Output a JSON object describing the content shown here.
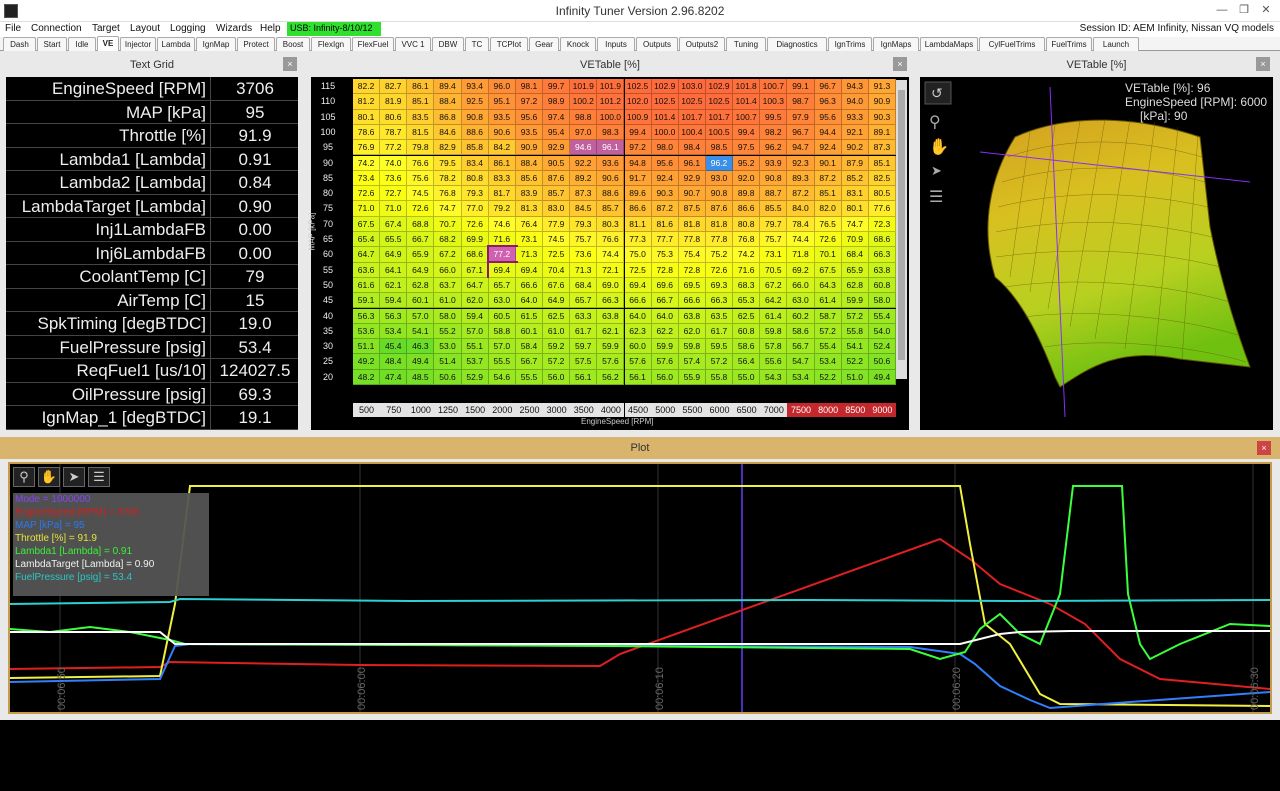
{
  "window": {
    "title": "Infinity Tuner Version 2.96.8202"
  },
  "menu": {
    "items": [
      "File",
      "Connection",
      "Target",
      "Layout",
      "Logging",
      "Wizards",
      "Help"
    ],
    "usb_status": "USB: Infinity-8/10/12",
    "session": "Session ID: AEM Infinity, Nissan VQ models"
  },
  "tabs": [
    "Dash",
    "Start",
    "Idle",
    "VE",
    "Injector",
    "Lambda",
    "IgnMap",
    "Protect",
    "Boost",
    "FlexIgn",
    "FlexFuel",
    "VVC 1",
    "DBW",
    "TC",
    "TCPlot",
    "Gear",
    "Knock",
    "Inputs",
    "Outputs",
    "Outputs2",
    "Tuning",
    "Diagnostics",
    "IgnTrims",
    "IgnMaps",
    "LambdaMaps",
    "CylFuelTrims",
    "FuelTrims",
    "Launch"
  ],
  "active_tab": "VE",
  "text_grid": {
    "title": "Text Grid",
    "rows": [
      {
        "name": "EngineSpeed [RPM]",
        "value": "3706"
      },
      {
        "name": "MAP [kPa]",
        "value": "95"
      },
      {
        "name": "Throttle [%]",
        "value": "91.9"
      },
      {
        "name": "Lambda1 [Lambda]",
        "value": "0.91"
      },
      {
        "name": "Lambda2 [Lambda]",
        "value": "0.84"
      },
      {
        "name": "LambdaTarget [Lambda]",
        "value": "0.90"
      },
      {
        "name": "Inj1LambdaFB",
        "value": "0.00"
      },
      {
        "name": "Inj6LambdaFB",
        "value": "0.00"
      },
      {
        "name": "CoolantTemp [C]",
        "value": "79"
      },
      {
        "name": "AirTemp [C]",
        "value": "15"
      },
      {
        "name": "SpkTiming [degBTDC]",
        "value": "19.0"
      },
      {
        "name": "FuelPressure [psig]",
        "value": "53.4"
      },
      {
        "name": "ReqFuel1 [us/10]",
        "value": "124027.5"
      },
      {
        "name": "OilPressure [psig]",
        "value": "69.3"
      },
      {
        "name": "IgnMap_1 [degBTDC]",
        "value": "19.1"
      }
    ]
  },
  "ve_table": {
    "title": "VETable [%]",
    "x_axis_label": "EngineSpeed [RPM]",
    "y_axis_label": "MAP [kPa]",
    "x": [
      "500",
      "750",
      "1000",
      "1250",
      "1500",
      "2000",
      "2500",
      "3000",
      "3500",
      "4000",
      "4500",
      "5000",
      "5500",
      "6000",
      "6500",
      "7000",
      "7500",
      "8000",
      "8500",
      "9000"
    ],
    "y": [
      "115",
      "110",
      "105",
      "100",
      "95",
      "90",
      "85",
      "80",
      "75",
      "70",
      "65",
      "60",
      "55",
      "50",
      "45",
      "40",
      "35",
      "30",
      "25",
      "20"
    ],
    "rows": [
      [
        "82.2",
        "82.7",
        "86.1",
        "89.4",
        "93.4",
        "96.0",
        "98.1",
        "99.7",
        "101.9",
        "101.9",
        "102.5",
        "102.9",
        "103.0",
        "102.9",
        "101.8",
        "100.7",
        "99.1",
        "96.7",
        "94.3",
        "91.3"
      ],
      [
        "81.2",
        "81.9",
        "85.1",
        "88.4",
        "92.5",
        "95.1",
        "97.2",
        "98.9",
        "100.2",
        "101.2",
        "102.0",
        "102.5",
        "102.5",
        "102.5",
        "101.4",
        "100.3",
        "98.7",
        "96.3",
        "94.0",
        "90.9"
      ],
      [
        "80.1",
        "80.6",
        "83.5",
        "86.8",
        "90.8",
        "93.5",
        "95.6",
        "97.4",
        "98.8",
        "100.0",
        "100.9",
        "101.4",
        "101.7",
        "101.7",
        "100.7",
        "99.5",
        "97.9",
        "95.6",
        "93.3",
        "90.3"
      ],
      [
        "78.6",
        "78.7",
        "81.5",
        "84.6",
        "88.6",
        "90.6",
        "93.5",
        "95.4",
        "97.0",
        "98.3",
        "99.4",
        "100.0",
        "100.4",
        "100.5",
        "99.4",
        "98.2",
        "96.7",
        "94.4",
        "92.1",
        "89.1"
      ],
      [
        "76.9",
        "77.2",
        "79.8",
        "82.9",
        "85.8",
        "84.2",
        "90.9",
        "92.9",
        "94.6",
        "96.1",
        "97.2",
        "98.0",
        "98.4",
        "98.5",
        "97.5",
        "96.2",
        "94.7",
        "92.4",
        "90.2",
        "87.3"
      ],
      [
        "74.2",
        "74.0",
        "76.6",
        "79.5",
        "83.4",
        "86.1",
        "88.4",
        "90.5",
        "92.2",
        "93.6",
        "94.8",
        "95.6",
        "96.1",
        "96.2",
        "95.2",
        "93.9",
        "92.3",
        "90.1",
        "87.9",
        "85.1"
      ],
      [
        "73.4",
        "73.6",
        "75.6",
        "78.2",
        "80.8",
        "83.3",
        "85.6",
        "87.6",
        "89.2",
        "90.6",
        "91.7",
        "92.4",
        "92.9",
        "93.0",
        "92.0",
        "90.8",
        "89.3",
        "87.2",
        "85.2",
        "82.5"
      ],
      [
        "72.6",
        "72.7",
        "74.5",
        "76.8",
        "79.3",
        "81.7",
        "83.9",
        "85.7",
        "87.3",
        "88.6",
        "89.6",
        "90.3",
        "90.7",
        "90.8",
        "89.8",
        "88.7",
        "87.2",
        "85.1",
        "83.1",
        "80.5"
      ],
      [
        "71.0",
        "71.0",
        "72.6",
        "74.7",
        "77.0",
        "79.2",
        "81.3",
        "83.0",
        "84.5",
        "85.7",
        "86.6",
        "87.2",
        "87.5",
        "87.6",
        "86.6",
        "85.5",
        "84.0",
        "82.0",
        "80.1",
        "77.6"
      ],
      [
        "67.5",
        "67.4",
        "68.8",
        "70.7",
        "72.6",
        "74.6",
        "76.4",
        "77.9",
        "79.3",
        "80.3",
        "81.1",
        "81.6",
        "81.8",
        "81.8",
        "80.8",
        "79.7",
        "78.4",
        "76.5",
        "74.7",
        "72.3"
      ],
      [
        "65.4",
        "65.5",
        "66.7",
        "68.2",
        "69.9",
        "71.6",
        "73.1",
        "74.5",
        "75.7",
        "76.6",
        "77.3",
        "77.7",
        "77.8",
        "77.8",
        "76.8",
        "75.7",
        "74.4",
        "72.6",
        "70.9",
        "68.6"
      ],
      [
        "64.7",
        "64.9",
        "65.9",
        "67.2",
        "68.6",
        "77.2",
        "71.3",
        "72.5",
        "73.6",
        "74.4",
        "75.0",
        "75.3",
        "75.4",
        "75.2",
        "74.2",
        "73.1",
        "71.8",
        "70.1",
        "68.4",
        "66.3"
      ],
      [
        "63.6",
        "64.1",
        "64.9",
        "66.0",
        "67.1",
        "69.4",
        "69.4",
        "70.4",
        "71.3",
        "72.1",
        "72.5",
        "72.8",
        "72.8",
        "72.6",
        "71.6",
        "70.5",
        "69.2",
        "67.5",
        "65.9",
        "63.8"
      ],
      [
        "61.6",
        "62.1",
        "62.8",
        "63.7",
        "64.7",
        "65.7",
        "66.6",
        "67.6",
        "68.4",
        "69.0",
        "69.4",
        "69.6",
        "69.5",
        "69.3",
        "68.3",
        "67.2",
        "66.0",
        "64.3",
        "62.8",
        "60.8"
      ],
      [
        "59.1",
        "59.4",
        "60.1",
        "61.0",
        "62.0",
        "63.0",
        "64.0",
        "64.9",
        "65.7",
        "66.3",
        "66.6",
        "66.7",
        "66.6",
        "66.3",
        "65.3",
        "64.2",
        "63.0",
        "61.4",
        "59.9",
        "58.0"
      ],
      [
        "56.3",
        "56.3",
        "57.0",
        "58.0",
        "59.4",
        "60.5",
        "61.5",
        "62.5",
        "63.3",
        "63.8",
        "64.0",
        "64.0",
        "63.8",
        "63.5",
        "62.5",
        "61.4",
        "60.2",
        "58.7",
        "57.2",
        "55.4"
      ],
      [
        "53.6",
        "53.4",
        "54.1",
        "55.2",
        "57.0",
        "58.8",
        "60.1",
        "61.0",
        "61.7",
        "62.1",
        "62.3",
        "62.2",
        "62.0",
        "61.7",
        "60.8",
        "59.8",
        "58.6",
        "57.2",
        "55.8",
        "54.0"
      ],
      [
        "51.1",
        "45.4",
        "46.3",
        "53.0",
        "55.1",
        "57.0",
        "58.4",
        "59.2",
        "59.7",
        "59.9",
        "60.0",
        "59.9",
        "59.8",
        "59.5",
        "58.6",
        "57.8",
        "56.7",
        "55.4",
        "54.1",
        "52.4"
      ],
      [
        "49.2",
        "48.4",
        "49.4",
        "51.4",
        "53.7",
        "55.5",
        "56.7",
        "57.2",
        "57.5",
        "57.6",
        "57.6",
        "57.6",
        "57.4",
        "57.2",
        "56.4",
        "55.6",
        "54.7",
        "53.4",
        "52.2",
        "50.6"
      ],
      [
        "48.2",
        "47.4",
        "48.5",
        "50.6",
        "52.9",
        "54.6",
        "55.5",
        "56.0",
        "56.1",
        "56.2",
        "56.1",
        "56.0",
        "55.9",
        "55.8",
        "55.0",
        "54.3",
        "53.4",
        "52.2",
        "51.0",
        "49.4"
      ]
    ],
    "highlight": {
      "row": 4,
      "cols": [
        8,
        9
      ]
    },
    "blue_cell": {
      "row": 5,
      "col": 13
    },
    "selected": {
      "row": 11,
      "col": 5
    },
    "cursor": {
      "row": 12,
      "col": 5
    },
    "red_x_labels": [
      "7500",
      "8000",
      "8500",
      "9000"
    ]
  },
  "ve_3d": {
    "title": "VETable [%]",
    "readouts": [
      "VETable [%]: 96",
      "EngineSpeed [RPM]: 6000",
      "[kPa]: 90"
    ]
  },
  "plot": {
    "title": "Plot",
    "legend": [
      {
        "label": "Mode = 1000000",
        "color": "#8a4bff"
      },
      {
        "label": "EngineSpeed [RPM] = 3706",
        "color": "#e02020"
      },
      {
        "label": "MAP [kPa] = 95",
        "color": "#2f7fff"
      },
      {
        "label": "Throttle [%] = 91.9",
        "color": "#f0f040"
      },
      {
        "label": "Lambda1 [Lambda] = 0.91",
        "color": "#3cff3c"
      },
      {
        "label": "LambdaTarget [Lambda] = 0.90",
        "color": "#ffffff"
      },
      {
        "label": "FuelPressure [psig] = 53.4",
        "color": "#2fd0d0"
      }
    ],
    "time_labels": [
      "00:06:50",
      "00:06:00",
      "00:06:10",
      "00:06:20",
      "00:06:30"
    ]
  }
}
